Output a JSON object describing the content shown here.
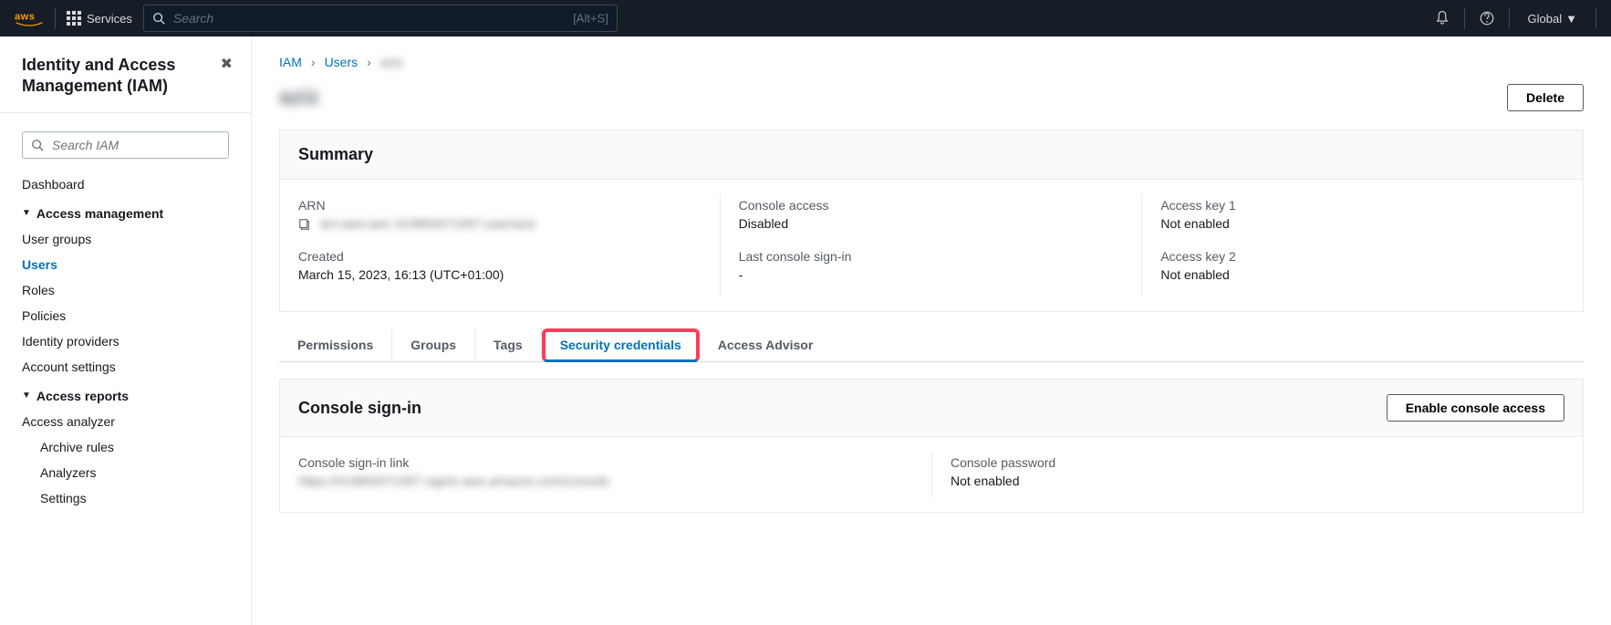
{
  "topnav": {
    "services_label": "Services",
    "search_placeholder": "Search",
    "search_shortcut": "[Alt+S]",
    "region": "Global"
  },
  "sidebar": {
    "title": "Identity and Access Management (IAM)",
    "search_placeholder": "Search IAM",
    "dashboard": "Dashboard",
    "section_access": "Access management",
    "items_access": [
      "User groups",
      "Users",
      "Roles",
      "Policies",
      "Identity providers",
      "Account settings"
    ],
    "section_reports": "Access reports",
    "items_reports": [
      "Access analyzer"
    ],
    "items_reports_sub": [
      "Archive rules",
      "Analyzers",
      "Settings"
    ]
  },
  "breadcrumb": {
    "iam": "IAM",
    "users": "Users",
    "current": "aziz"
  },
  "page": {
    "title": "aziz",
    "delete": "Delete"
  },
  "summary": {
    "title": "Summary",
    "arn_label": "ARN",
    "arn_value": "arn:aws:iam::019850071957:user/aziz",
    "console_access_label": "Console access",
    "console_access_value": "Disabled",
    "access_key1_label": "Access key 1",
    "access_key1_value": "Not enabled",
    "created_label": "Created",
    "created_value": "March 15, 2023, 16:13 (UTC+01:00)",
    "last_signin_label": "Last console sign-in",
    "last_signin_value": "-",
    "access_key2_label": "Access key 2",
    "access_key2_value": "Not enabled"
  },
  "tabs": {
    "permissions": "Permissions",
    "groups": "Groups",
    "tags": "Tags",
    "security": "Security credentials",
    "advisor": "Access Advisor"
  },
  "console_signin": {
    "title": "Console sign-in",
    "enable_btn": "Enable console access",
    "link_label": "Console sign-in link",
    "link_value": "https://019850071957.signin.aws.amazon.com/console",
    "password_label": "Console password",
    "password_value": "Not enabled"
  }
}
